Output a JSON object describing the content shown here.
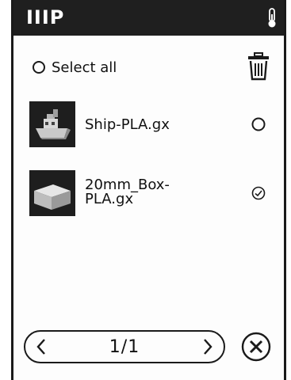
{
  "header": {
    "title": "IIIP",
    "status_icon": "thermometer-icon"
  },
  "toolbar": {
    "select_all_label": "Select all",
    "delete_icon": "trash-icon"
  },
  "files": [
    {
      "name": "Ship-PLA.gx",
      "thumbnail": "ship-thumbnail",
      "selected": false
    },
    {
      "name_line1": "20mm_Box-",
      "name_line2": "PLA.gx",
      "thumbnail": "box-thumbnail",
      "selected": true
    }
  ],
  "pager": {
    "page_text": "1/1",
    "prev_icon": "chevron-left-icon",
    "next_icon": "chevron-right-icon"
  },
  "close": {
    "icon": "close-icon"
  }
}
